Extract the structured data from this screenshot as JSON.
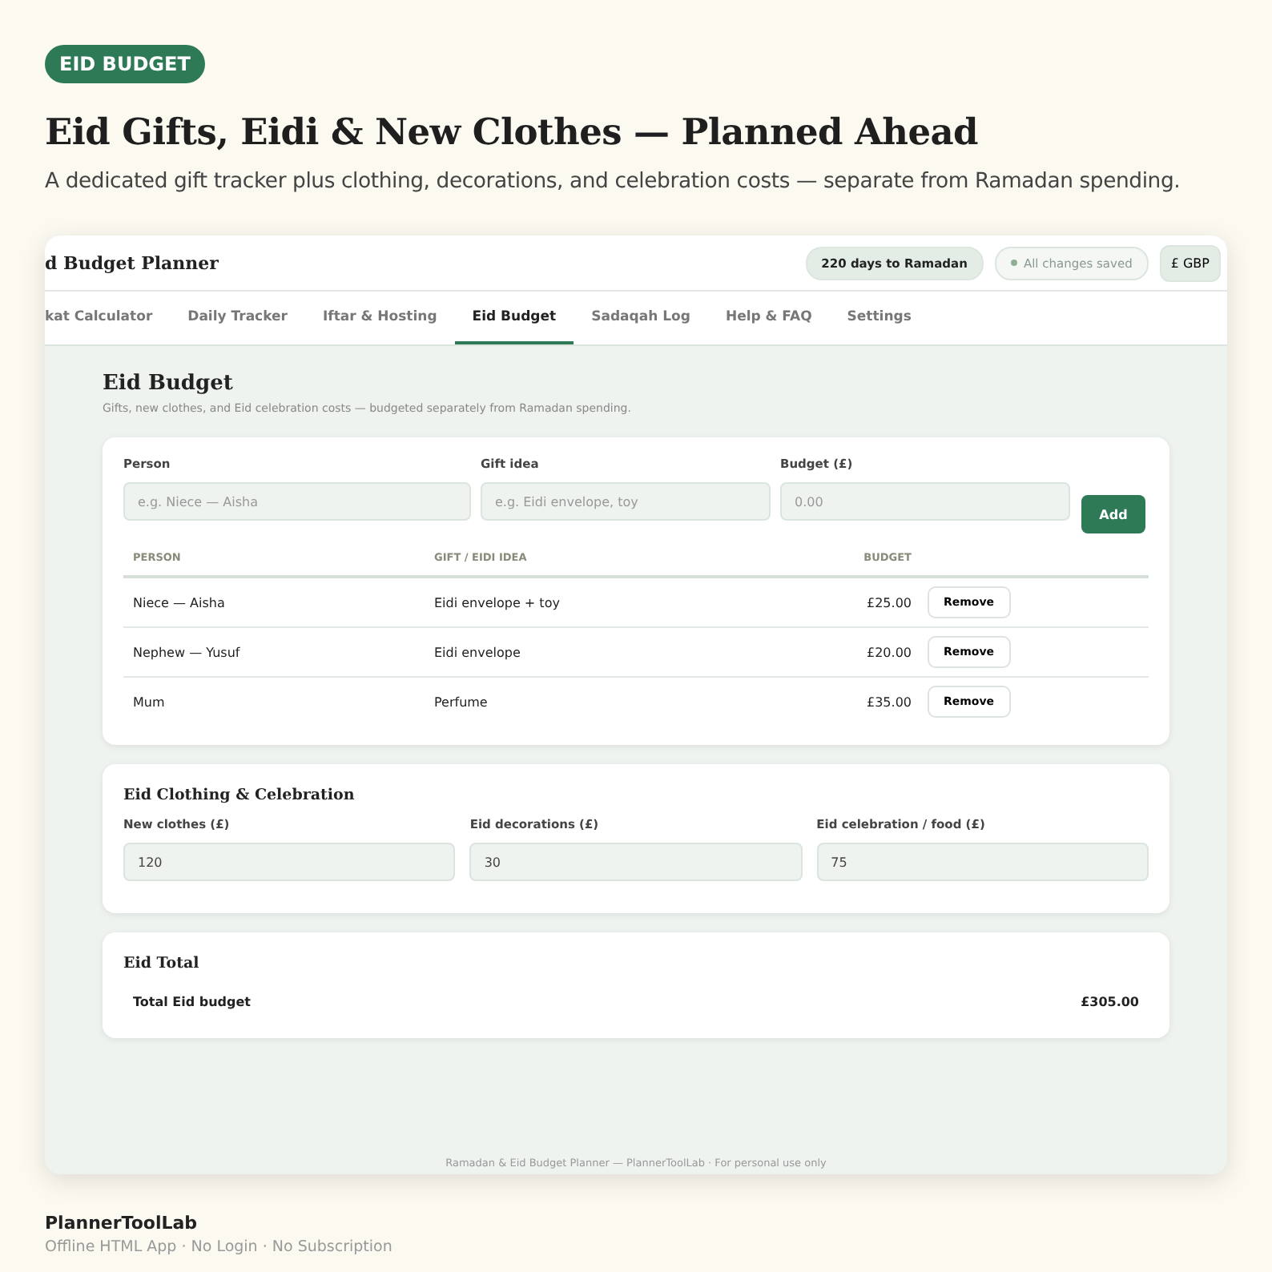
{
  "badge": "EID BUDGET",
  "headline": "Eid Gifts, Eidi & New Clothes — Planned Ahead",
  "subheadline": "A dedicated gift tracker plus clothing, decorations, and celebration costs — separate from Ramadan spending.",
  "app": {
    "title": "d Budget Planner",
    "countdown": "220 days to Ramadan",
    "save_status": "All changes saved",
    "currency": "£ GBP",
    "tabs": [
      {
        "label": "kat Calculator",
        "selected": false
      },
      {
        "label": "Daily Tracker",
        "selected": false
      },
      {
        "label": "Iftar & Hosting",
        "selected": false
      },
      {
        "label": "Eid Budget",
        "selected": true
      },
      {
        "label": "Sadaqah Log",
        "selected": false
      },
      {
        "label": "Help & FAQ",
        "selected": false
      },
      {
        "label": "Settings",
        "selected": false
      }
    ],
    "page_title": "Eid Budget",
    "page_subtitle": "Gifts, new clothes, and Eid celebration costs — budgeted separately from Ramadan spending.",
    "gift_form": {
      "fields": [
        {
          "label": "Person",
          "placeholder": "e.g. Niece — Aisha"
        },
        {
          "label": "Gift idea",
          "placeholder": "e.g. Eidi envelope, toy"
        },
        {
          "label": "Budget (£)",
          "placeholder": "0.00"
        }
      ],
      "add_button": "Add"
    },
    "gift_table": {
      "columns": [
        "PERSON",
        "GIFT / EIDI IDEA",
        "BUDGET"
      ],
      "rows": [
        {
          "person": "Niece — Aisha",
          "gift": "Eidi envelope + toy",
          "budget": "£25.00",
          "action": "Remove"
        },
        {
          "person": "Nephew — Yusuf",
          "gift": "Eidi envelope",
          "budget": "£20.00",
          "action": "Remove"
        },
        {
          "person": "Mum",
          "gift": "Perfume",
          "budget": "£35.00",
          "action": "Remove"
        }
      ]
    },
    "clothing": {
      "title": "Eid Clothing & Celebration",
      "fields": [
        {
          "label": "New clothes (£)",
          "value": "120"
        },
        {
          "label": "Eid decorations (£)",
          "value": "30"
        },
        {
          "label": "Eid celebration / food (£)",
          "value": "75"
        }
      ]
    },
    "total": {
      "title": "Eid Total",
      "label": "Total Eid budget",
      "value": "£305.00"
    },
    "footer": "Ramadan & Eid Budget Planner — PlannerToolLab · For personal use only"
  },
  "brand": "PlannerToolLab",
  "tagline": "Offline HTML App · No Login · No Subscription"
}
